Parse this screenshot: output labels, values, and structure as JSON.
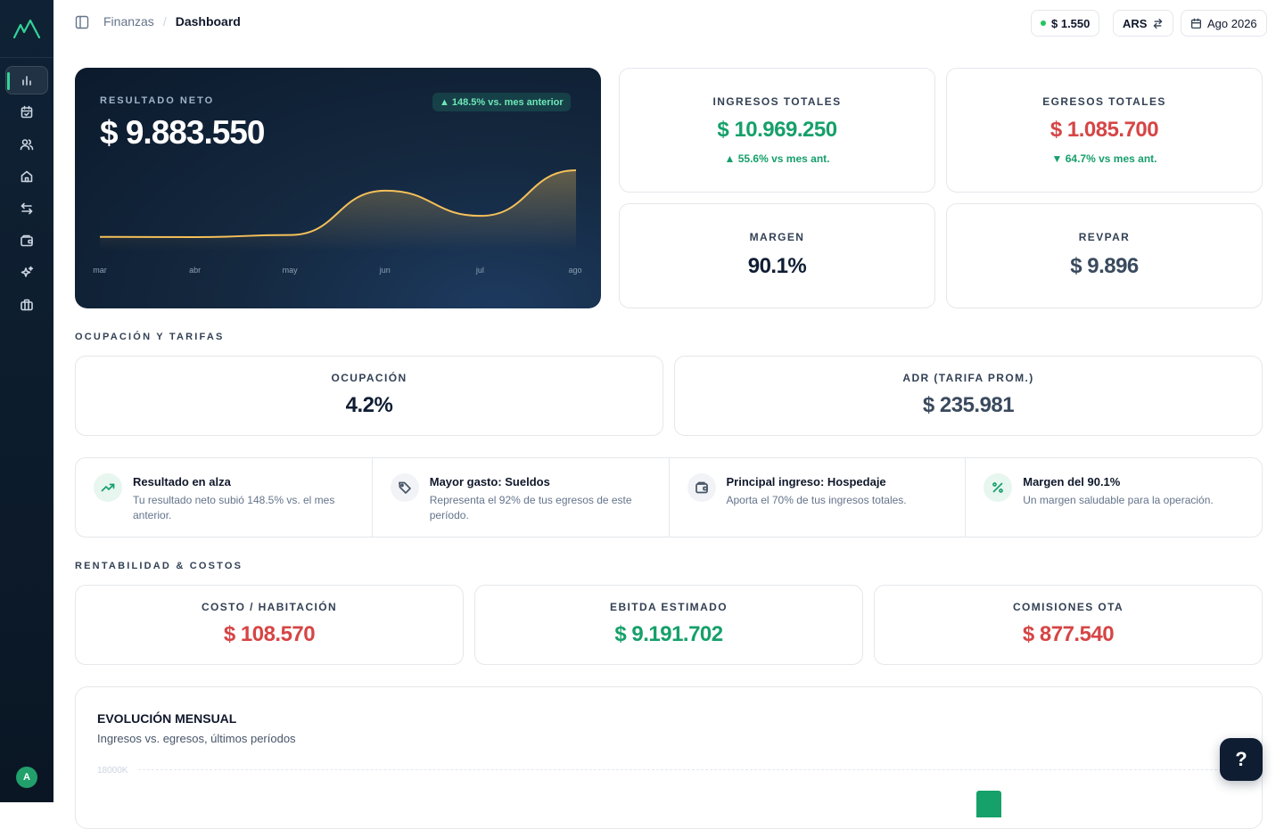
{
  "app": {
    "user_initial": "A"
  },
  "breadcrumb": {
    "parent": "Finanzas",
    "separator": "/",
    "current": "Dashboard"
  },
  "topbar": {
    "exchange_rate": "$ 1.550",
    "currency": "ARS",
    "period": "Ago 2026",
    "status_color": "#22c55e"
  },
  "sidebar": {
    "items": [
      {
        "name": "chart-icon",
        "active": true
      },
      {
        "name": "calendar-icon",
        "active": false
      },
      {
        "name": "users-icon",
        "active": false
      },
      {
        "name": "home-icon",
        "active": false
      },
      {
        "name": "transfer-icon",
        "active": false
      },
      {
        "name": "wallet-icon",
        "active": false
      },
      {
        "name": "sparkle-icon",
        "active": false
      },
      {
        "name": "briefcase-icon",
        "active": false
      }
    ]
  },
  "hero": {
    "label": "RESULTADO NETO",
    "value": "$ 9.883.550",
    "badge": "148.5% vs. mes anterior",
    "months": [
      "mar",
      "abr",
      "may",
      "jun",
      "jul",
      "ago"
    ],
    "series": [
      120000,
      90000,
      400000,
      6900000,
      3200000,
      9883550
    ]
  },
  "kpis": {
    "ingresos": {
      "label": "INGRESOS TOTALES",
      "value": "$ 10.969.250",
      "change": "55.6% vs mes ant."
    },
    "egresos": {
      "label": "EGRESOS TOTALES",
      "value": "$ 1.085.700",
      "change": "64.7% vs mes ant."
    },
    "margen": {
      "label": "MARGEN",
      "value": "90.1%"
    },
    "revpar": {
      "label": "REVPAR",
      "value": "$ 9.896"
    }
  },
  "ocupacion_section": {
    "title": "OCUPACIÓN Y TARIFAS",
    "ocupacion": {
      "label": "OCUPACIÓN",
      "value": "4.2%"
    },
    "adr": {
      "label": "ADR (TARIFA PROM.)",
      "value": "$ 235.981"
    }
  },
  "insights": [
    {
      "icon": "trending-up-icon",
      "title": "Resultado en alza",
      "text": "Tu resultado neto subió 148.5% vs. el mes anterior."
    },
    {
      "icon": "tag-icon",
      "title": "Mayor gasto: Sueldos",
      "text": "Representa el 92% de tus egresos de este período."
    },
    {
      "icon": "wallet-icon",
      "title": "Principal ingreso: Hospedaje",
      "text": "Aporta el 70% de tus ingresos totales."
    },
    {
      "icon": "percent-icon",
      "title": "Margen del 90.1%",
      "text": "Un margen saludable para la operación."
    }
  ],
  "rentabilidad_section": {
    "title": "RENTABILIDAD & COSTOS",
    "costo": {
      "label": "COSTO / HABITACIÓN",
      "value": "$ 108.570"
    },
    "ebitda": {
      "label": "EBITDA ESTIMADO",
      "value": "$ 9.191.702"
    },
    "comisiones": {
      "label": "COMISIONES OTA",
      "value": "$ 877.540"
    }
  },
  "monthly": {
    "title": "EVOLUCIÓN MENSUAL",
    "subtitle": "Ingresos vs. egresos, últimos períodos",
    "top_tick": "18000K"
  },
  "help": {
    "label": "?"
  },
  "colors": {
    "positive": "#16a06a",
    "negative": "#d64545",
    "accent": "#34d399",
    "line": "#f5c05a"
  }
}
